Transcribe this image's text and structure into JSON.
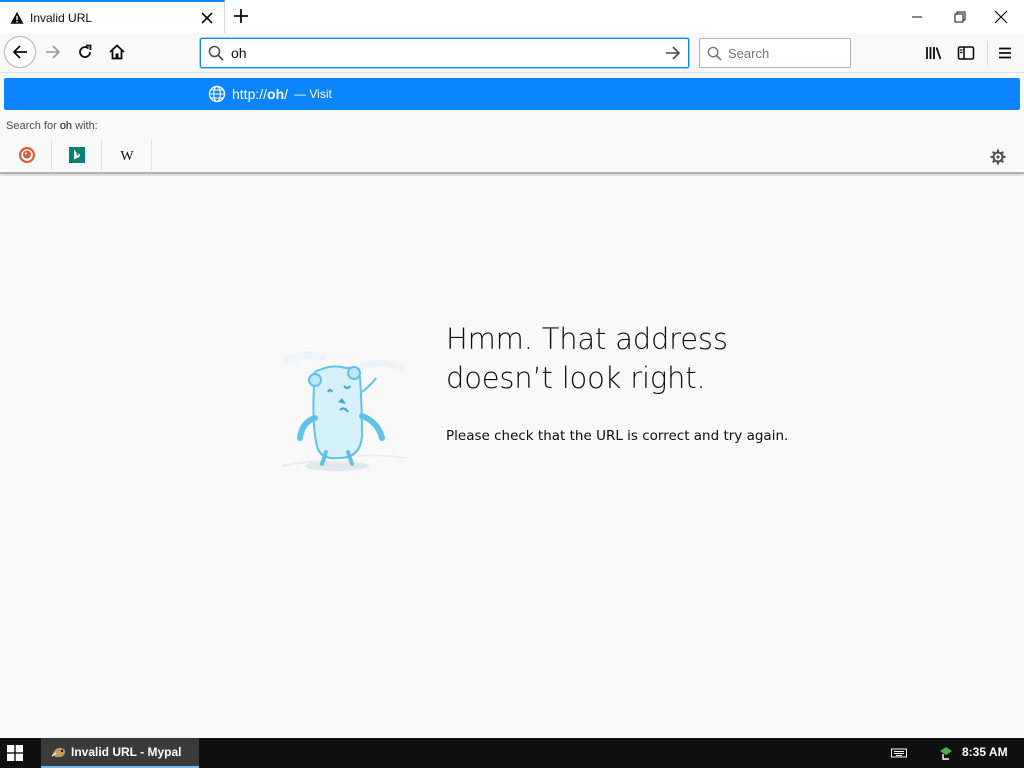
{
  "tab": {
    "title": "Invalid URL",
    "icon": "warning-icon"
  },
  "urlbar": {
    "value": "oh",
    "placeholder": ""
  },
  "searchbar": {
    "placeholder": "Search"
  },
  "popup": {
    "suggestion_prefix": "http://",
    "suggestion_host": "oh",
    "suggestion_suffix": "/",
    "suggestion_action": "— Visit",
    "search_for_prefix": "Search for ",
    "search_for_term": "oh",
    "search_for_suffix": " with:",
    "engines": [
      "duckduckgo",
      "bing",
      "wikipedia"
    ]
  },
  "error": {
    "title_line1": "Hmm. That address",
    "title_line2": "doesn’t look right.",
    "description": "Please check that the URL is correct and try again."
  },
  "taskbar": {
    "item_label": "Invalid URL - Mypal",
    "clock": "8:35 AM"
  },
  "colors": {
    "accent": "#0a84ff",
    "page_bg": "#f9f9fa",
    "taskbar": "#101010"
  }
}
